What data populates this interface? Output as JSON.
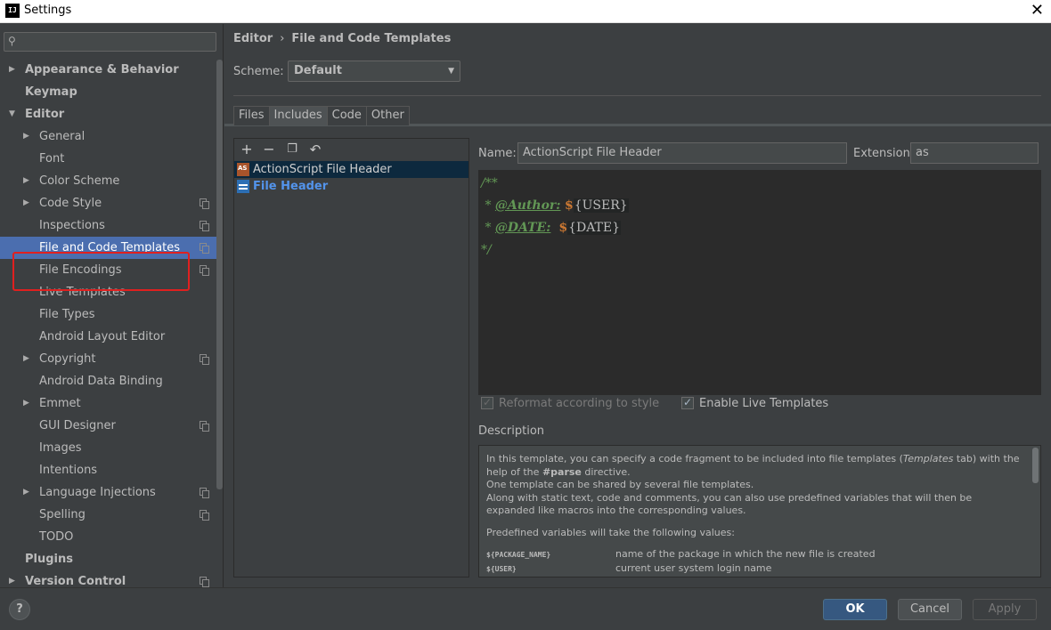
{
  "window": {
    "title": "Settings",
    "app_icon": "IJ"
  },
  "sidebar": {
    "search_placeholder": "",
    "items": [
      {
        "label": "Appearance & Behavior",
        "level": 0,
        "bold": true,
        "arrow": "right"
      },
      {
        "label": "Keymap",
        "level": 0,
        "bold": true
      },
      {
        "label": "Editor",
        "level": 0,
        "bold": true,
        "arrow": "down"
      },
      {
        "label": "General",
        "level": 1,
        "arrow": "right"
      },
      {
        "label": "Font",
        "level": 1
      },
      {
        "label": "Color Scheme",
        "level": 1,
        "arrow": "right"
      },
      {
        "label": "Code Style",
        "level": 1,
        "arrow": "right",
        "copy": true
      },
      {
        "label": "Inspections",
        "level": 1,
        "copy": true
      },
      {
        "label": "File and Code Templates",
        "level": 1,
        "copy": true,
        "selected": true
      },
      {
        "label": "File Encodings",
        "level": 1,
        "copy": true
      },
      {
        "label": "Live Templates",
        "level": 1
      },
      {
        "label": "File Types",
        "level": 1
      },
      {
        "label": "Android Layout Editor",
        "level": 1
      },
      {
        "label": "Copyright",
        "level": 1,
        "arrow": "right",
        "copy": true
      },
      {
        "label": "Android Data Binding",
        "level": 1
      },
      {
        "label": "Emmet",
        "level": 1,
        "arrow": "right"
      },
      {
        "label": "GUI Designer",
        "level": 1,
        "copy": true
      },
      {
        "label": "Images",
        "level": 1
      },
      {
        "label": "Intentions",
        "level": 1
      },
      {
        "label": "Language Injections",
        "level": 1,
        "arrow": "right",
        "copy": true
      },
      {
        "label": "Spelling",
        "level": 1,
        "copy": true
      },
      {
        "label": "TODO",
        "level": 1
      },
      {
        "label": "Plugins",
        "level": 0,
        "bold": true
      },
      {
        "label": "Version Control",
        "level": 0,
        "bold": true,
        "arrow": "right",
        "copy": true
      }
    ]
  },
  "breadcrumb": {
    "parent": "Editor",
    "separator": "›",
    "current": "File and Code Templates"
  },
  "scheme": {
    "label": "Scheme:",
    "value": "Default"
  },
  "tabs": [
    "Files",
    "Includes",
    "Code",
    "Other"
  ],
  "active_tab": "Includes",
  "template_list": [
    {
      "label": "ActionScript File Header",
      "icon": "actionscript-file-icon",
      "selected": true
    },
    {
      "label": "File Header",
      "icon": "file-header-icon",
      "selected": false
    }
  ],
  "name_field": {
    "label": "Name:",
    "value": "ActionScript File Header"
  },
  "extension_field": {
    "label": "Extension:",
    "value": "as"
  },
  "code": {
    "line1": "/**",
    "line2_prefix": " * ",
    "line2_tag": "@Author:",
    "line2_dollar": "$",
    "line2_var": "{USER}",
    "line3_prefix": " * ",
    "line3_tag": "@DATE:",
    "line3_dollar": "$",
    "line3_var": "{DATE}",
    "line4": "*/"
  },
  "checkboxes": {
    "reformat": "Reformat according to style",
    "live_templates": "Enable Live Templates"
  },
  "description": {
    "title": "Description",
    "p1_a": "In this template, you can specify a code fragment to be included into file templates (",
    "p1_b": "Templates",
    "p1_c": " tab) with the help of the ",
    "p1_d": "#parse",
    "p1_e": " directive.",
    "p2": "One template can be shared by several file templates.",
    "p3": "Along with static text, code and comments, you can also use predefined variables that will then be expanded like macros into the corresponding values.",
    "p4": "Predefined variables will take the following values:",
    "var1_name": "${PACKAGE_NAME}",
    "var1_desc": "name of the package in which the new file is created",
    "var2_name": "${USER}",
    "var2_desc": "current user system login name"
  },
  "buttons": {
    "help": "?",
    "ok": "OK",
    "cancel": "Cancel",
    "apply": "Apply"
  },
  "colors": {
    "selection": "#4b6eaf",
    "highlight_box": "#e0201f",
    "ok_button": "#365880",
    "link": "#5394ec"
  }
}
